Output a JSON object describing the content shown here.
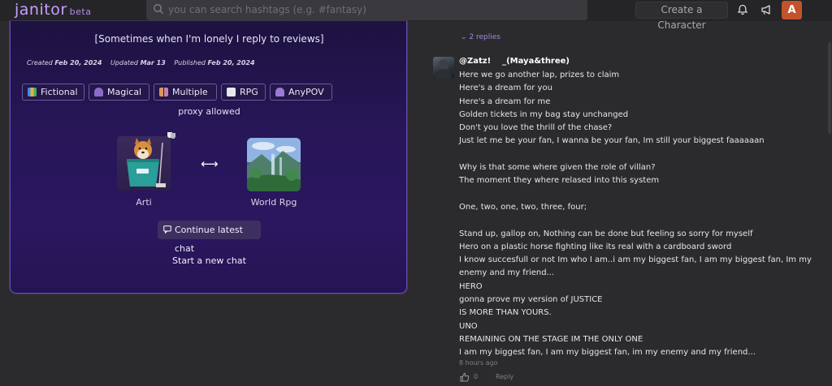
{
  "topbar": {
    "logo": "janitor",
    "logo_badge": "beta",
    "search_placeholder": "you can search hashtags (e.g. #fantasy)",
    "create_label": "Create a Character",
    "avatar_letter": "A",
    "avatar_color": "#c2532b"
  },
  "card": {
    "tagline": "[Sometimes when I'm lonely I reply to reviews]",
    "created_label": "Created",
    "created_date": "Feb 20, 2024",
    "updated_label": "Updated",
    "updated_date": "Mar 13",
    "published_label": "Published",
    "published_date": "Feb 20, 2024",
    "tags": [
      {
        "label": "Fictional",
        "icon": "books-icon"
      },
      {
        "label": "Magical",
        "icon": "wizard-icon"
      },
      {
        "label": "Multiple",
        "icon": "people-icon"
      },
      {
        "label": "RPG",
        "icon": "dice-icon"
      },
      {
        "label": "AnyPOV",
        "icon": "person-icon"
      }
    ],
    "proxy_text": "proxy allowed",
    "characters": [
      {
        "name": "Arti"
      },
      {
        "name": "World Rpg"
      }
    ],
    "continue_label": "Continue latest chat",
    "new_chat_label": "Start a new chat"
  },
  "comments": {
    "replies_label": "2 replies",
    "username": "@Zatz!    _(Maya&three)",
    "lines": [
      "Here we go another lap, prizes to claim",
      "Here's a dream for you",
      "Here's a dream for me",
      "Golden tickets in my bag stay unchanged",
      "Don't you love the thrill of the chase?",
      "Just let me be your fan, I wanna be your fan, Im still your biggest faaaaaan",
      "",
      "Why is that some where given the role of villan?",
      "The moment they where relased into this system",
      "",
      "One, two, one, two, three, four;",
      "",
      "Stand up, gallop on, Nothing can be done but feeling so sorry for myself",
      "Hero on a plastic horse fighting like its real with a cardboard sword",
      "I know succesfull or not Im who I am..i am my biggest fan, I am my biggest fan, Im my",
      "enemy and my friend...",
      "HERO",
      "gonna prove my version of JUSTICE",
      "IS MORE THAN YOURS.",
      "UNO",
      "REMAINING ON THE STAGE IM THE ONLY ONE",
      "I am my biggest fan, I am my biggest fan, im my enemy and my friend..."
    ],
    "timestamp": "8 hours ago",
    "like_count": "0",
    "reply_label": "Reply"
  }
}
